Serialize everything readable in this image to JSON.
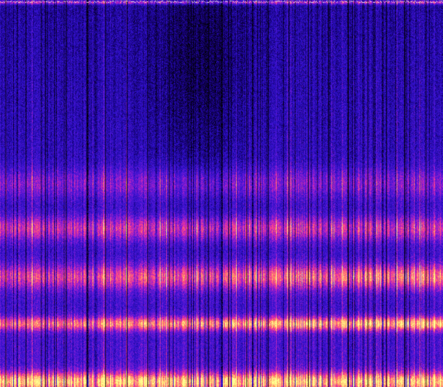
{
  "image": {
    "kind": "spectrogram",
    "colormap": [
      "#000000",
      "#14006e",
      "#2c10c8",
      "#5a18d8",
      "#b020c8",
      "#ff4088",
      "#ffa060",
      "#ffff90"
    ],
    "background_color": "#0a0040",
    "gridlines": "vertical",
    "bands": [
      {
        "name": "top-edge",
        "level": 0.6
      },
      {
        "name": "upper-faint",
        "level": 0.35
      },
      {
        "name": "middle",
        "level": 0.55
      },
      {
        "name": "lower",
        "level": 0.75
      },
      {
        "name": "strong",
        "level": 0.95
      },
      {
        "name": "bottom-edge",
        "level": 1.0
      }
    ]
  }
}
